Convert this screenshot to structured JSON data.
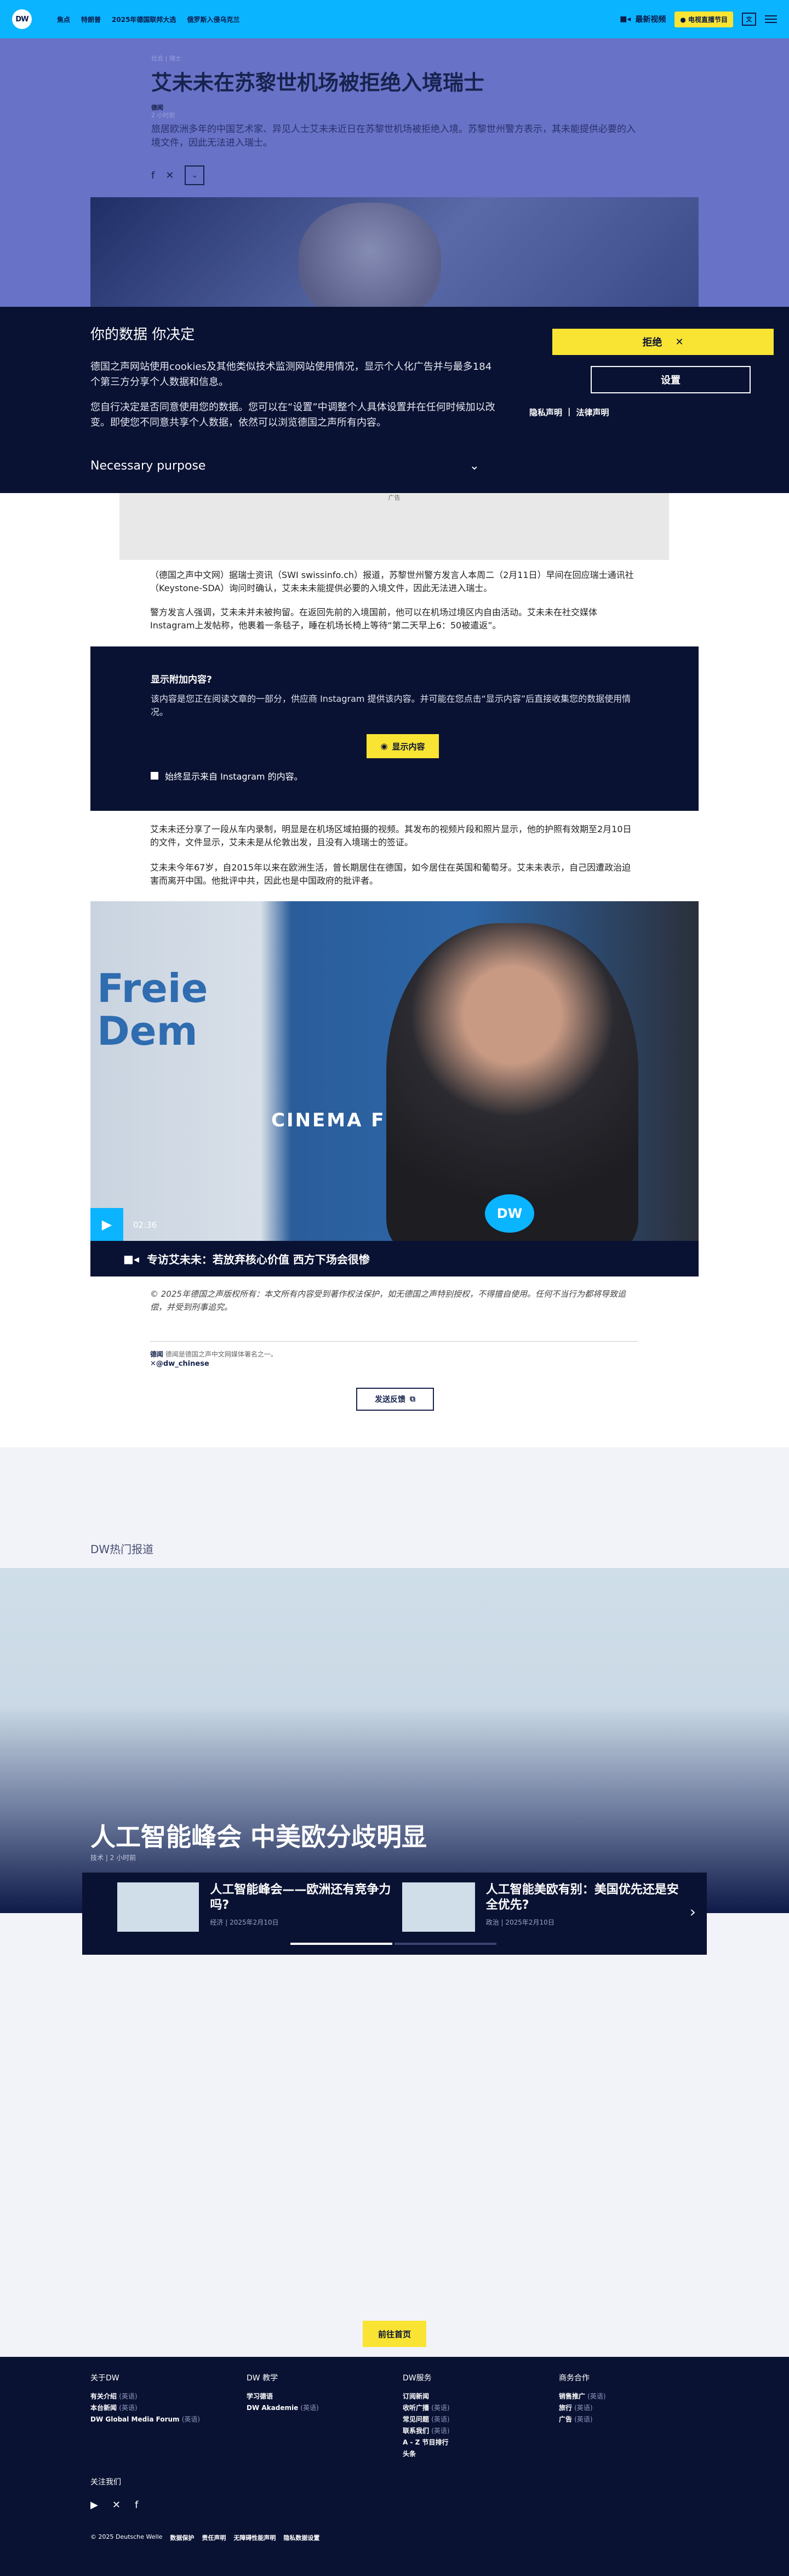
{
  "header": {
    "logo": "DW",
    "nav": [
      "焦点",
      "特朗普",
      "2025年德国联邦大选",
      "俄罗斯入侵乌克兰"
    ],
    "latest_video": "最新视频",
    "live_tv": "电视直播节目",
    "lang": "文"
  },
  "article": {
    "category": "社会 | 瑞士",
    "title": "艾未未在苏黎世机场被拒绝入境瑞士",
    "source": "德闻",
    "time": "2 小时前",
    "lead": "旅居欧洲多年的中国艺术家、异见人士艾未未近日在苏黎世机场被拒绝入境。苏黎世州警方表示，其未能提供必要的入境文件，因此无法进入瑞士。",
    "para1": "（德国之声中文网）据瑞士资讯（SWI swissinfo.ch）报道，苏黎世州警方发言人本周二（2月11日）早间在回应瑞士通讯社（Keystone-SDA）询问时确认，艾未未未能提供必要的入境文件，因此无法进入瑞士。",
    "para2": "警方发言人强调，艾未未并未被拘留。在返回先前的入境国前，他可以在机场过境区内自由活动。艾未未在社交媒体Instagram上发帖称，他裹着一条毯子，睡在机场长椅上等待“第二天早上6：50被遣返”。",
    "para3": "艾未未还分享了一段从车内录制，明显是在机场区域拍摄的视频。其发布的视频片段和照片显示，他的护照有效期至2月10日的文件，文件显示，艾未未是从伦敦出发，且没有入境瑞士的签证。",
    "para4": "艾未未今年67岁，自2015年以来在欧洲生活，曾长期居住在德国，如今居住在英国和葡萄牙。艾未未表示，自己因遭政治迫害而离开中国。他批评中共，因此也是中国政府的批评者。",
    "ad_label": "广告",
    "copyright": "© 2025年德国之声版权所有：本文所有内容受到著作权法保护，如无德国之声特别授权，不得擅自使用。任何不当行为都将导致追偿，并受到刑事追究。",
    "source_line_bold": "德闻",
    "source_line": "德闻是德国之声中文网媒体署名之一。",
    "handle": "@dw_chinese",
    "feedback": "发送反馈"
  },
  "cookie": {
    "title": "你的数据 你决定",
    "p1": "德国之声网站使用cookies及其他类似技术监测网站使用情况，显示个人化广告并与最多184 个第三方分享个人数据和信息。",
    "p2": "您自行决定是否同意使用您的数据。您可以在“设置”中调整个人具体设置并在任何时候加以改变。即使您不同意共享个人数据，依然可以浏览德国之声所有内容。",
    "reject": "拒绝",
    "settings": "设置",
    "privacy": "隐私声明",
    "legal": "法律声明",
    "purpose": "Necessary purpose"
  },
  "instagram": {
    "title": "显示附加内容?",
    "text": "该内容是您正在阅读文章的一部分，供应商 Instagram 提供该内容。并可能在您点击“显示内容”后直接收集您的数据使用情况。",
    "show": "显示内容",
    "always": "始终显示来自 Instagram 的内容。"
  },
  "video": {
    "duration": "02:36",
    "caption": "专访艾未未：若放弃核心价值 西方下场会很惨",
    "word1": "Freie",
    "word2": "Dem",
    "cinema": "CINEMA FO",
    "dw": "DW"
  },
  "trending": {
    "label": "DW热门报道",
    "headline": "人工智能峰会 中美欧分歧明显",
    "meta": "技术 | 2 小时前",
    "cards": [
      {
        "title": "人工智能峰会——欧洲还有竞争力吗?",
        "meta": "经济 | 2025年2月10日"
      },
      {
        "title": "人工智能美欧有别：美国优先还是安全优先?",
        "meta": "政治 | 2025年2月10日"
      }
    ],
    "home": "前往首页"
  },
  "footer": {
    "cols": [
      {
        "title": "关于DW",
        "items": [
          {
            "t": "有关介绍",
            "s": "(英语)"
          },
          {
            "t": "本台新闻",
            "s": "(英语)"
          },
          {
            "t": "DW Global Media Forum",
            "s": "(英语)"
          }
        ]
      },
      {
        "title": "DW 教学",
        "items": [
          {
            "t": "学习德语",
            "s": ""
          },
          {
            "t": "DW Akademie",
            "s": "(英语)"
          }
        ]
      },
      {
        "title": "DW服务",
        "items": [
          {
            "t": "订阅新闻",
            "s": ""
          },
          {
            "t": "收听广播",
            "s": "(英语)"
          },
          {
            "t": "常见问题",
            "s": "(英语)"
          },
          {
            "t": "联系我们",
            "s": "(英语)"
          },
          {
            "t": "A - Z 节目排行",
            "s": ""
          },
          {
            "t": "头条",
            "s": ""
          }
        ]
      },
      {
        "title": "商务合作",
        "items": [
          {
            "t": "销售推广",
            "s": "(英语)"
          },
          {
            "t": "旅行",
            "s": "(英语)"
          },
          {
            "t": "广告",
            "s": "(英语)"
          }
        ]
      }
    ],
    "follow": "关注我们",
    "bottom": [
      "© 2025 Deutsche Welle",
      "数据保护",
      "责任声明",
      "无障碍性能声明",
      "隐私数据设置"
    ]
  }
}
